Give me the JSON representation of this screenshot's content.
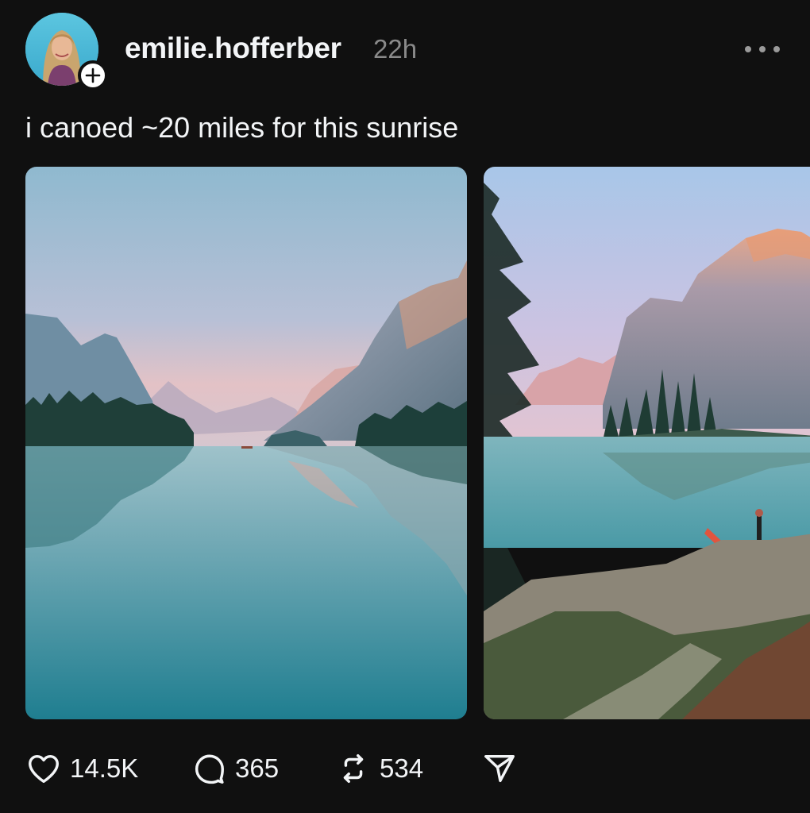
{
  "post": {
    "author": {
      "username": "emilie.hofferber",
      "avatar_icon": "profile-photo",
      "follow_icon": "plus-icon"
    },
    "timestamp": "22h",
    "caption": "i canoed ~20 miles for this sunrise",
    "media": [
      {
        "icon": "photo-lake-mountain-reflection"
      },
      {
        "icon": "photo-lake-canoe-island"
      }
    ],
    "stats": {
      "likes": "14.5K",
      "replies": "365",
      "reposts": "534"
    },
    "icons": {
      "more": "more-horizontal-icon",
      "like": "heart-icon",
      "reply": "comment-bubble-icon",
      "repost": "repost-icon",
      "share": "send-icon"
    }
  },
  "colors": {
    "background": "#101010",
    "text_primary": "#f3f5f7",
    "text_secondary": "#8a8a8a"
  }
}
